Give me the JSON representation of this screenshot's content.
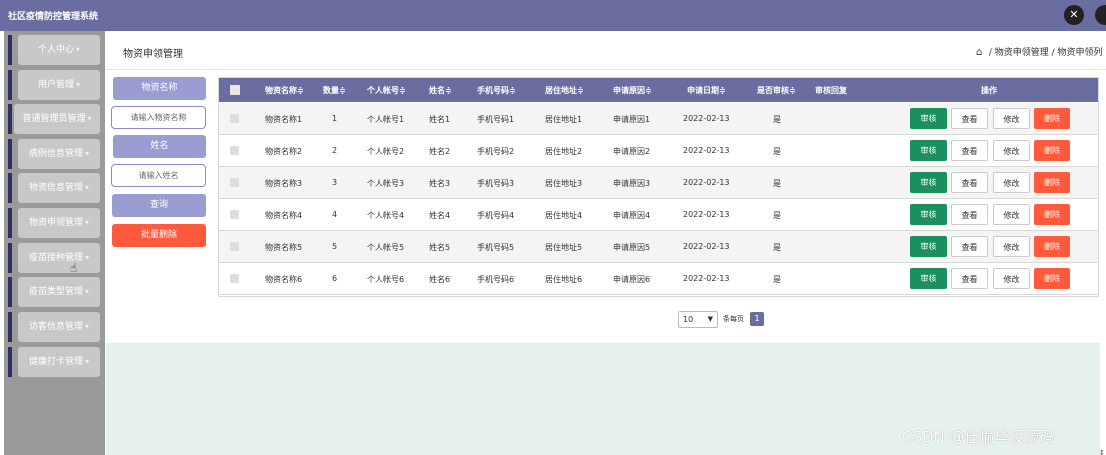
{
  "app": {
    "title": "社区疫情防控管理系统",
    "top_icons": [
      "close-icon",
      "user-icon"
    ]
  },
  "sidebar": {
    "items": [
      {
        "label": "个人中心"
      },
      {
        "label": "用户管理"
      },
      {
        "label": "普通管理员管理"
      },
      {
        "label": "病例信息管理"
      },
      {
        "label": "物资信息管理"
      },
      {
        "label": "物资申领管理"
      },
      {
        "label": "疫苗接种管理"
      },
      {
        "label": "疫苗类型管理"
      },
      {
        "label": "访客信息管理"
      },
      {
        "label": "健康打卡管理"
      }
    ]
  },
  "header": {
    "page_title": "物资申领管理",
    "breadcrumb": "/ 物资申领管理 / 物资申领列"
  },
  "search": {
    "name_label": "物资名称",
    "name_placeholder": "请输入物资名称",
    "person_label": "姓名",
    "person_placeholder": "请输入姓名",
    "query_button": "查询",
    "batch_delete_button": "批量删除"
  },
  "table": {
    "columns": [
      "物资名称",
      "数量",
      "个人帐号",
      "姓名",
      "手机号码",
      "居住地址",
      "申请原因",
      "申请日期",
      "是否审核",
      "审核回复",
      "操作"
    ],
    "rows": [
      {
        "name": "物资名称1",
        "qty": "1",
        "account": "个人帐号1",
        "person": "姓名1",
        "phone": "手机号码1",
        "address": "居住地址1",
        "reason": "申请原因1",
        "date": "2022-02-13",
        "audited": "是",
        "reply": ""
      },
      {
        "name": "物资名称2",
        "qty": "2",
        "account": "个人帐号2",
        "person": "姓名2",
        "phone": "手机号码2",
        "address": "居住地址2",
        "reason": "申请原因2",
        "date": "2022-02-13",
        "audited": "是",
        "reply": ""
      },
      {
        "name": "物资名称3",
        "qty": "3",
        "account": "个人帐号3",
        "person": "姓名3",
        "phone": "手机号码3",
        "address": "居住地址3",
        "reason": "申请原因3",
        "date": "2022-02-13",
        "audited": "是",
        "reply": ""
      },
      {
        "name": "物资名称4",
        "qty": "4",
        "account": "个人帐号4",
        "person": "姓名4",
        "phone": "手机号码4",
        "address": "居住地址4",
        "reason": "申请原因4",
        "date": "2022-02-13",
        "audited": "是",
        "reply": ""
      },
      {
        "name": "物资名称5",
        "qty": "5",
        "account": "个人帐号5",
        "person": "姓名5",
        "phone": "手机号码5",
        "address": "居住地址5",
        "reason": "申请原因5",
        "date": "2022-02-13",
        "audited": "是",
        "reply": ""
      },
      {
        "name": "物资名称6",
        "qty": "6",
        "account": "个人帐号6",
        "person": "姓名6",
        "phone": "手机号码6",
        "address": "居住地址6",
        "reason": "申请原因6",
        "date": "2022-02-13",
        "audited": "是",
        "reply": ""
      }
    ],
    "actions": {
      "audit": "审核",
      "view": "查看",
      "edit": "修改",
      "delete": "删除"
    }
  },
  "pagination": {
    "page_size": "10",
    "per_page_text": "条每页",
    "current_page": "1"
  },
  "watermark": "CSDN @佳愉毕设源码",
  "colors": {
    "header": "#6a6d9f",
    "accent_light": "#9a9dd1",
    "danger": "#ff5a3c",
    "success": "#1b8f5e",
    "bottom": "#e5f1ec"
  }
}
